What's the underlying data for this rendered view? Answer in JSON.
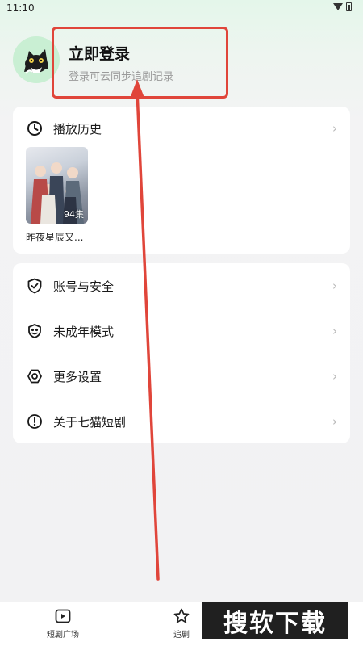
{
  "status_bar": {
    "time": "11:10"
  },
  "header": {
    "login_title": "立即登录",
    "login_subtitle": "登录可云同步追剧记录"
  },
  "history": {
    "title": "播放历史",
    "chevron": "›",
    "items": [
      {
        "title": "昨夜星辰又...",
        "episodes": "94集"
      }
    ]
  },
  "menu": {
    "items": [
      {
        "label": "账号与安全",
        "icon": "shield-check-icon",
        "chevron": "›"
      },
      {
        "label": "未成年模式",
        "icon": "youth-mode-icon",
        "chevron": "›"
      },
      {
        "label": "更多设置",
        "icon": "settings-hexagon-icon",
        "chevron": "›"
      },
      {
        "label": "关于七猫短剧",
        "icon": "info-exclamation-icon",
        "chevron": "›"
      }
    ]
  },
  "bottom_nav": {
    "tabs": [
      {
        "label": "短剧广场",
        "icon": "play-square-icon"
      },
      {
        "label": "追剧",
        "icon": "star-icon"
      }
    ]
  },
  "watermark": {
    "text": "搜软下载"
  },
  "colors": {
    "highlight_box": "#e0453a",
    "arrow": "#e0453a",
    "avatar_bg": "#c9efd3"
  }
}
